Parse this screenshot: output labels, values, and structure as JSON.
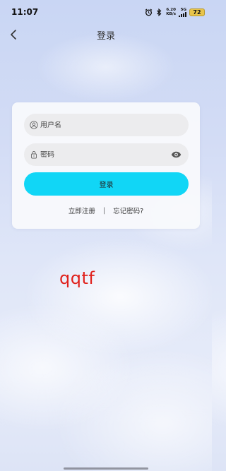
{
  "status_bar": {
    "time": "11:07",
    "net_speed_value": "6.20",
    "net_speed_unit": "KB/s",
    "signal_label": "5G",
    "battery": "72",
    "icons": [
      "alarm-icon",
      "bluetooth-icon",
      "signal-icon",
      "battery-icon"
    ]
  },
  "header": {
    "title": "登录",
    "back_icon": "chevron-left-icon"
  },
  "form": {
    "username_placeholder": "用户名",
    "password_placeholder": "密码",
    "login_label": "登录",
    "register_link": "立即注册",
    "divider": "|",
    "forgot_link": "忘记密码?"
  },
  "annotation": {
    "text": "qqtf"
  },
  "colors": {
    "accent": "#11d6f6",
    "annotation": "#e0201b",
    "battery": "#e8c44a"
  }
}
